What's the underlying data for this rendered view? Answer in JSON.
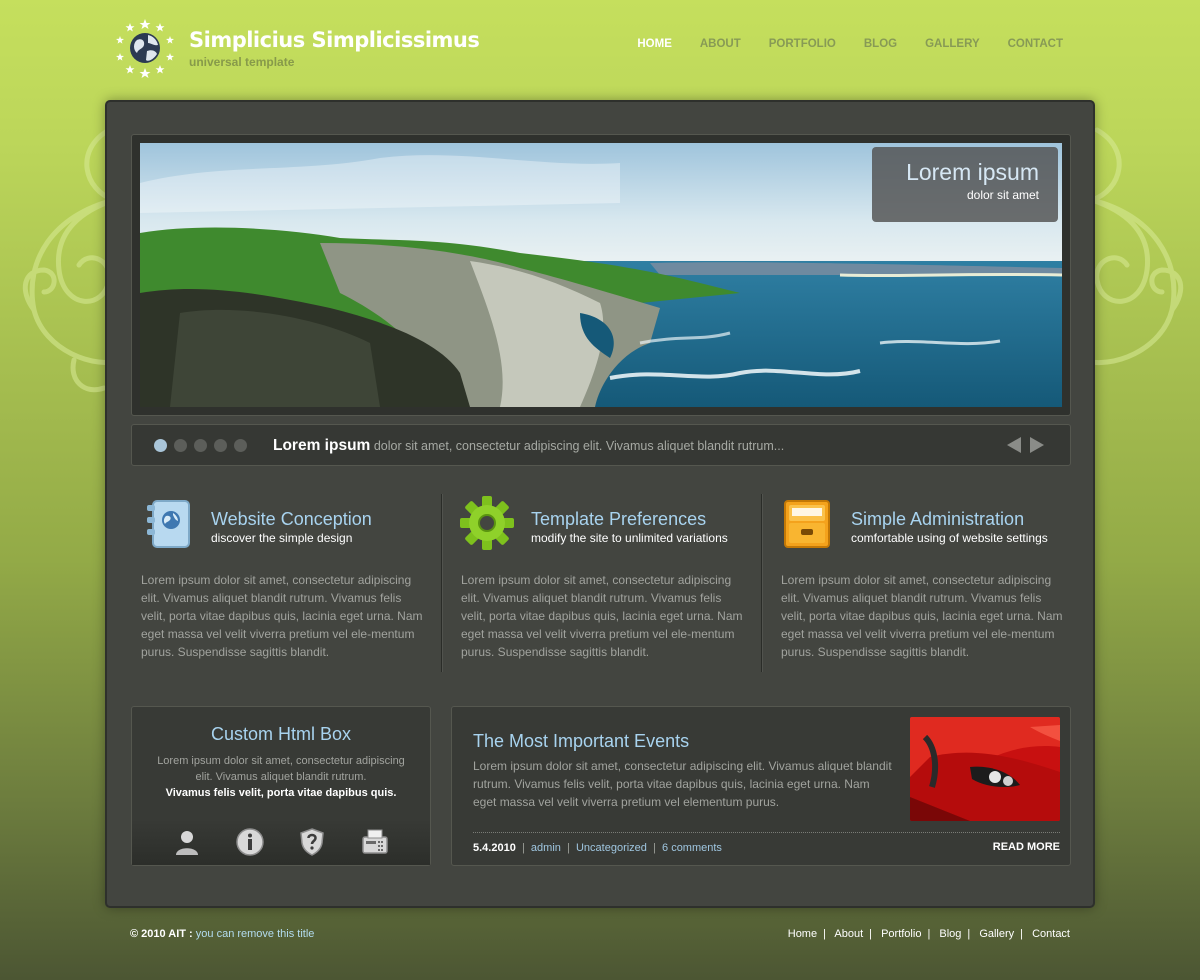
{
  "header": {
    "title": "Simplicius Simplicissimus",
    "subtitle": "universal template",
    "nav": [
      "HOME",
      "ABOUT",
      "PORTFOLIO",
      "BLOG",
      "GALLERY",
      "CONTACT"
    ],
    "active_nav": "HOME"
  },
  "slider": {
    "caption_title": "Lorem ipsum",
    "caption_subtitle": "dolor sit amet",
    "ticker_title": "Lorem ipsum",
    "ticker_text": "dolor sit amet, consectetur adipiscing elit. Vivamus aliquet blandit rutrum...",
    "dots_total": 5,
    "active_dot": 1
  },
  "features": [
    {
      "icon": "address-book-icon",
      "title": "Website Conception",
      "subtitle": "discover the simple design",
      "text": "Lorem ipsum dolor sit amet, consectetur adipiscing elit. Vivamus aliquet blandit rutrum. Vivamus felis velit, porta vitae dapibus quis, lacinia eget urna. Nam eget massa vel velit viverra pretium vel ele-mentum purus. Suspendisse sagittis blandit."
    },
    {
      "icon": "gear-icon",
      "title": "Template Preferences",
      "subtitle": "modify the site to unlimited variations",
      "text": "Lorem ipsum dolor sit amet, consectetur adipiscing elit. Vivamus aliquet blandit rutrum. Vivamus felis velit, porta vitae dapibus quis, lacinia eget urna. Nam eget massa vel velit viverra pretium vel ele-mentum purus. Suspendisse sagittis blandit."
    },
    {
      "icon": "file-drawer-icon",
      "title": "Simple Administration",
      "subtitle": "comfortable using of website settings",
      "text": "Lorem ipsum dolor sit amet, consectetur adipiscing elit. Vivamus aliquet blandit rutrum. Vivamus felis velit, porta vitae dapibus quis, lacinia eget urna. Nam eget massa vel velit viverra pretium vel ele-mentum purus. Suspendisse sagittis blandit."
    }
  ],
  "html_box": {
    "title": "Custom Html Box",
    "text": "Lorem ipsum dolor sit amet, consectetur adipiscing elit. Vivamus aliquet blandit rutrum.",
    "bold": "Vivamus felis velit, porta vitae dapibus quis.",
    "icons": [
      "user-icon",
      "info-icon",
      "shield-question-icon",
      "fax-icon"
    ]
  },
  "events": {
    "title": "The Most Important Events",
    "text": "Lorem ipsum dolor sit amet, consectetur adipiscing elit. Vivamus aliquet blandit rutrum. Vivamus felis velit, porta vitae dapibus quis, lacinia eget urna. Nam eget massa vel velit viverra pretium vel elementum purus.",
    "date": "5.4.2010",
    "author": "admin",
    "category": "Uncategorized",
    "comments": "6 comments",
    "read_more": "READ MORE"
  },
  "footer": {
    "copyright": "© 2010 AIT :",
    "note": "you can remove this title",
    "links": [
      "Home",
      "About",
      "Portfolio",
      "Blog",
      "Gallery",
      "Contact"
    ]
  },
  "colors": {
    "accent": "#a8d3ef",
    "background_top": "#c5df5d",
    "panel": "#434540"
  }
}
